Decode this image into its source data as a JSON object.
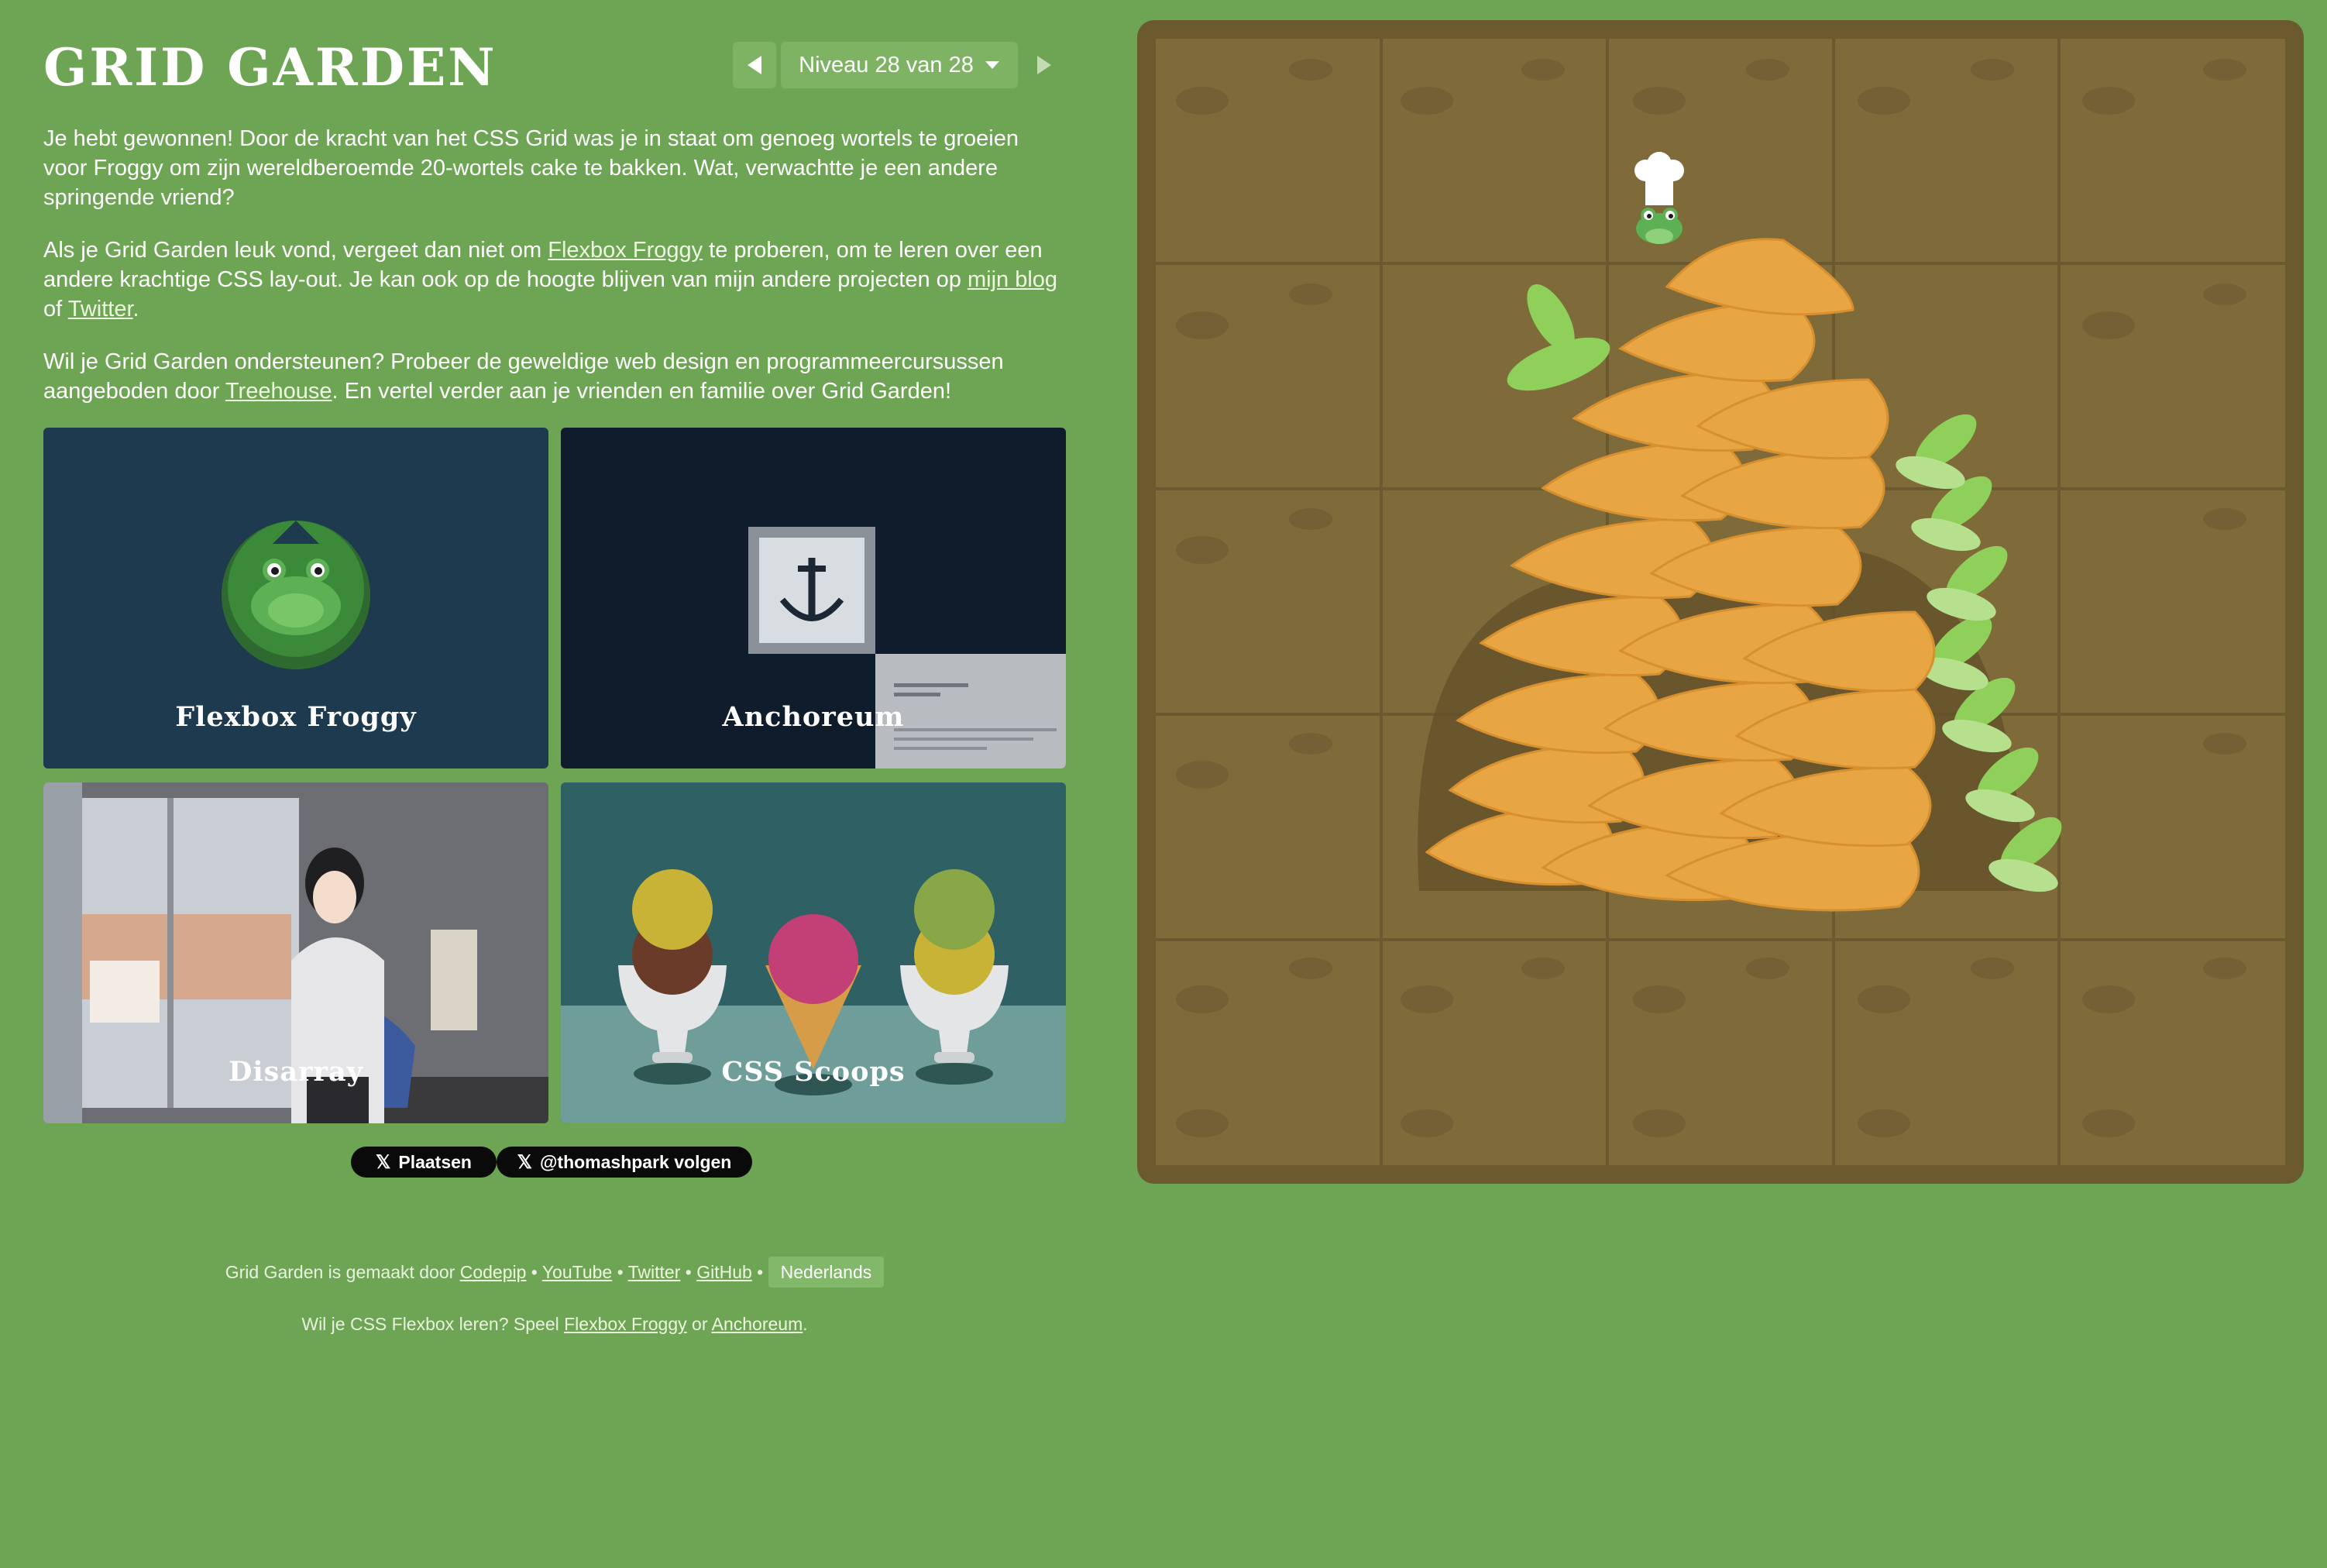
{
  "header": {
    "title": "GRID GARDEN",
    "level_label": "Niveau 28 van 28"
  },
  "intro": {
    "p1": "Je hebt gewonnen! Door de kracht van het CSS Grid was je in staat om genoeg wortels te groeien voor Froggy om zijn wereldberoemde 20-wortels cake te bakken. Wat, verwachtte je een andere springende vriend?",
    "p2_before": "Als je Grid Garden leuk vond, vergeet dan niet om ",
    "p2_link1": "Flexbox Froggy",
    "p2_mid": " te proberen, om te leren over een andere krachtige CSS lay-out. Je kan ook op de hoogte blijven van mijn andere projecten op ",
    "p2_link2": "mijn blog",
    "p2_mid2": " of ",
    "p2_link3": "Twitter",
    "p2_end": ".",
    "p3_before": "Wil je Grid Garden ondersteunen? Probeer de geweldige web design en programmeercursussen aangeboden door ",
    "p3_link": "Treehouse",
    "p3_end": ". En vertel verder aan je vrienden en familie over Grid Garden!"
  },
  "tiles": [
    {
      "label": "Flexbox Froggy"
    },
    {
      "label": "Anchoreum"
    },
    {
      "label": "Disarray"
    },
    {
      "label": "CSS Scoops"
    }
  ],
  "social": {
    "post_label": "Plaatsen",
    "follow_label": "@thomashpark volgen",
    "x_glyph": "𝕏"
  },
  "footer": {
    "made_by_prefix": "Grid Garden is gemaakt door ",
    "links": [
      "Codepip",
      "YouTube",
      "Twitter",
      "GitHub"
    ],
    "sep": " • ",
    "language": "Nederlands",
    "learn_prefix": "Wil je CSS Flexbox leren? Speel ",
    "learn_link1": "Flexbox Froggy",
    "learn_or": " or ",
    "learn_link2": "Anchoreum",
    "learn_end": "."
  },
  "colors": {
    "background": "#6ea554",
    "board_frame": "#6b5a2e",
    "board_soil": "#7f6a3a",
    "carrot": "#e8a543",
    "leaf": "#8fd05a"
  },
  "icons": {
    "prev": "triangle-left-icon",
    "next": "triangle-right-icon",
    "dropdown": "caret-down-icon"
  }
}
